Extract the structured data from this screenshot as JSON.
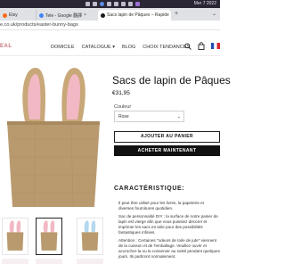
{
  "menubar": {
    "clock": "Mer 7 2022"
  },
  "browser": {
    "tabs": [
      {
        "label": "Etsy",
        "favicon_color": "#ff6a1a"
      },
      {
        "label": "Tele - Google 翻譯",
        "favicon_color": "#4285f4"
      },
      {
        "label": "Sacs lapin de Pâques – Rapide",
        "favicon_color": "#1a1a1a"
      }
    ],
    "close_glyph": "×",
    "new_tab_glyph": "+",
    "menu_glyph": "⌄",
    "url": "e.co.uk/products/easter-bunny-bags"
  },
  "site": {
    "logo": "EAL",
    "nav": [
      "DOMICILE",
      "CATALOGUE ▾",
      "BLOG",
      "CHOIX TENDANCES"
    ],
    "icons": [
      "search-icon",
      "bag-icon",
      "flag-icon"
    ]
  },
  "product": {
    "title": "Sacs de lapin de Pâques",
    "price": "€31,95",
    "color_label": "Couleur",
    "color_value": "Rose",
    "caret": "⌄",
    "add_to_cart": "AJOUTER AU PANIER",
    "buy_now": "ACHETER MAINTENANT",
    "features_title": "CARACTÉRISTIQUE:",
    "features": [
      "Il peut être utilisé pour les livres, la papeterie et diverses fournitures quotidien.",
      "Sac de personnalité DIY : la surface de notre panier de lapin est vierge afin que vous puissiez décorer et imprimer les sacs en toile pour des possibilités fantastiques infinies.",
      "Attention : Certaines \"odeurs de toile de jute\" viennent de la cuisson et de l'emballage. Veuillez ouvrir et accrocher-la ou la conserver au soleil pendant quelques jours. Ils partiront normalement."
    ]
  },
  "colors": {
    "menubar": "#2a2633",
    "burlap": "#b99a6e",
    "ear_pink": "#f2b8c4",
    "logo_pink": "#c86e7a"
  }
}
